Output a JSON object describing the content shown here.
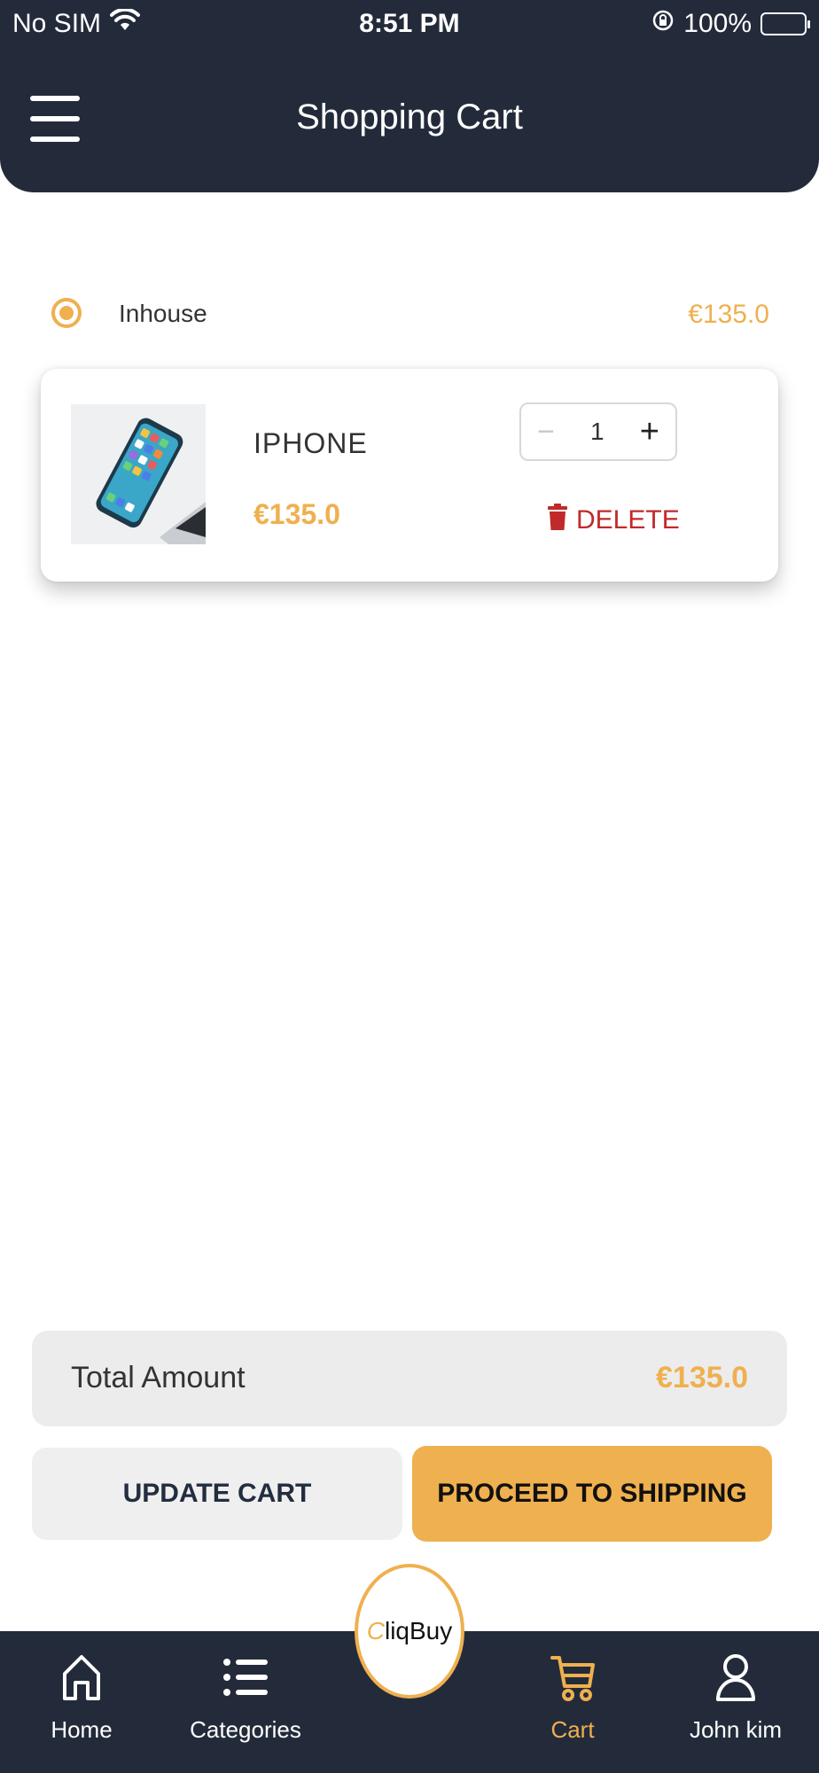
{
  "status_bar": {
    "carrier": "No SIM",
    "time": "8:51 PM",
    "battery": "100%"
  },
  "header": {
    "title": "Shopping Cart"
  },
  "seller": {
    "name": "Inhouse",
    "subtotal": "€135.0",
    "selected": true
  },
  "cart_items": [
    {
      "name": "IPHONE",
      "price": "€135.0",
      "quantity": "1",
      "delete_label": "DELETE"
    }
  ],
  "total": {
    "label": "Total Amount",
    "value": "€135.0"
  },
  "actions": {
    "update_label": "UPDATE CART",
    "proceed_label": "PROCEED TO SHIPPING"
  },
  "bottom_nav": {
    "items": [
      {
        "label": "Home",
        "icon": "home-icon"
      },
      {
        "label": "Categories",
        "icon": "list-icon"
      },
      {
        "label": "Cart",
        "icon": "cart-icon",
        "active": true
      },
      {
        "label": "John kim",
        "icon": "user-icon"
      }
    ],
    "logo_text": "liqBuy",
    "logo_initial": "C"
  },
  "colors": {
    "header_bg": "#232b3b",
    "accent": "#efb04f",
    "delete": "#c12a2a"
  }
}
